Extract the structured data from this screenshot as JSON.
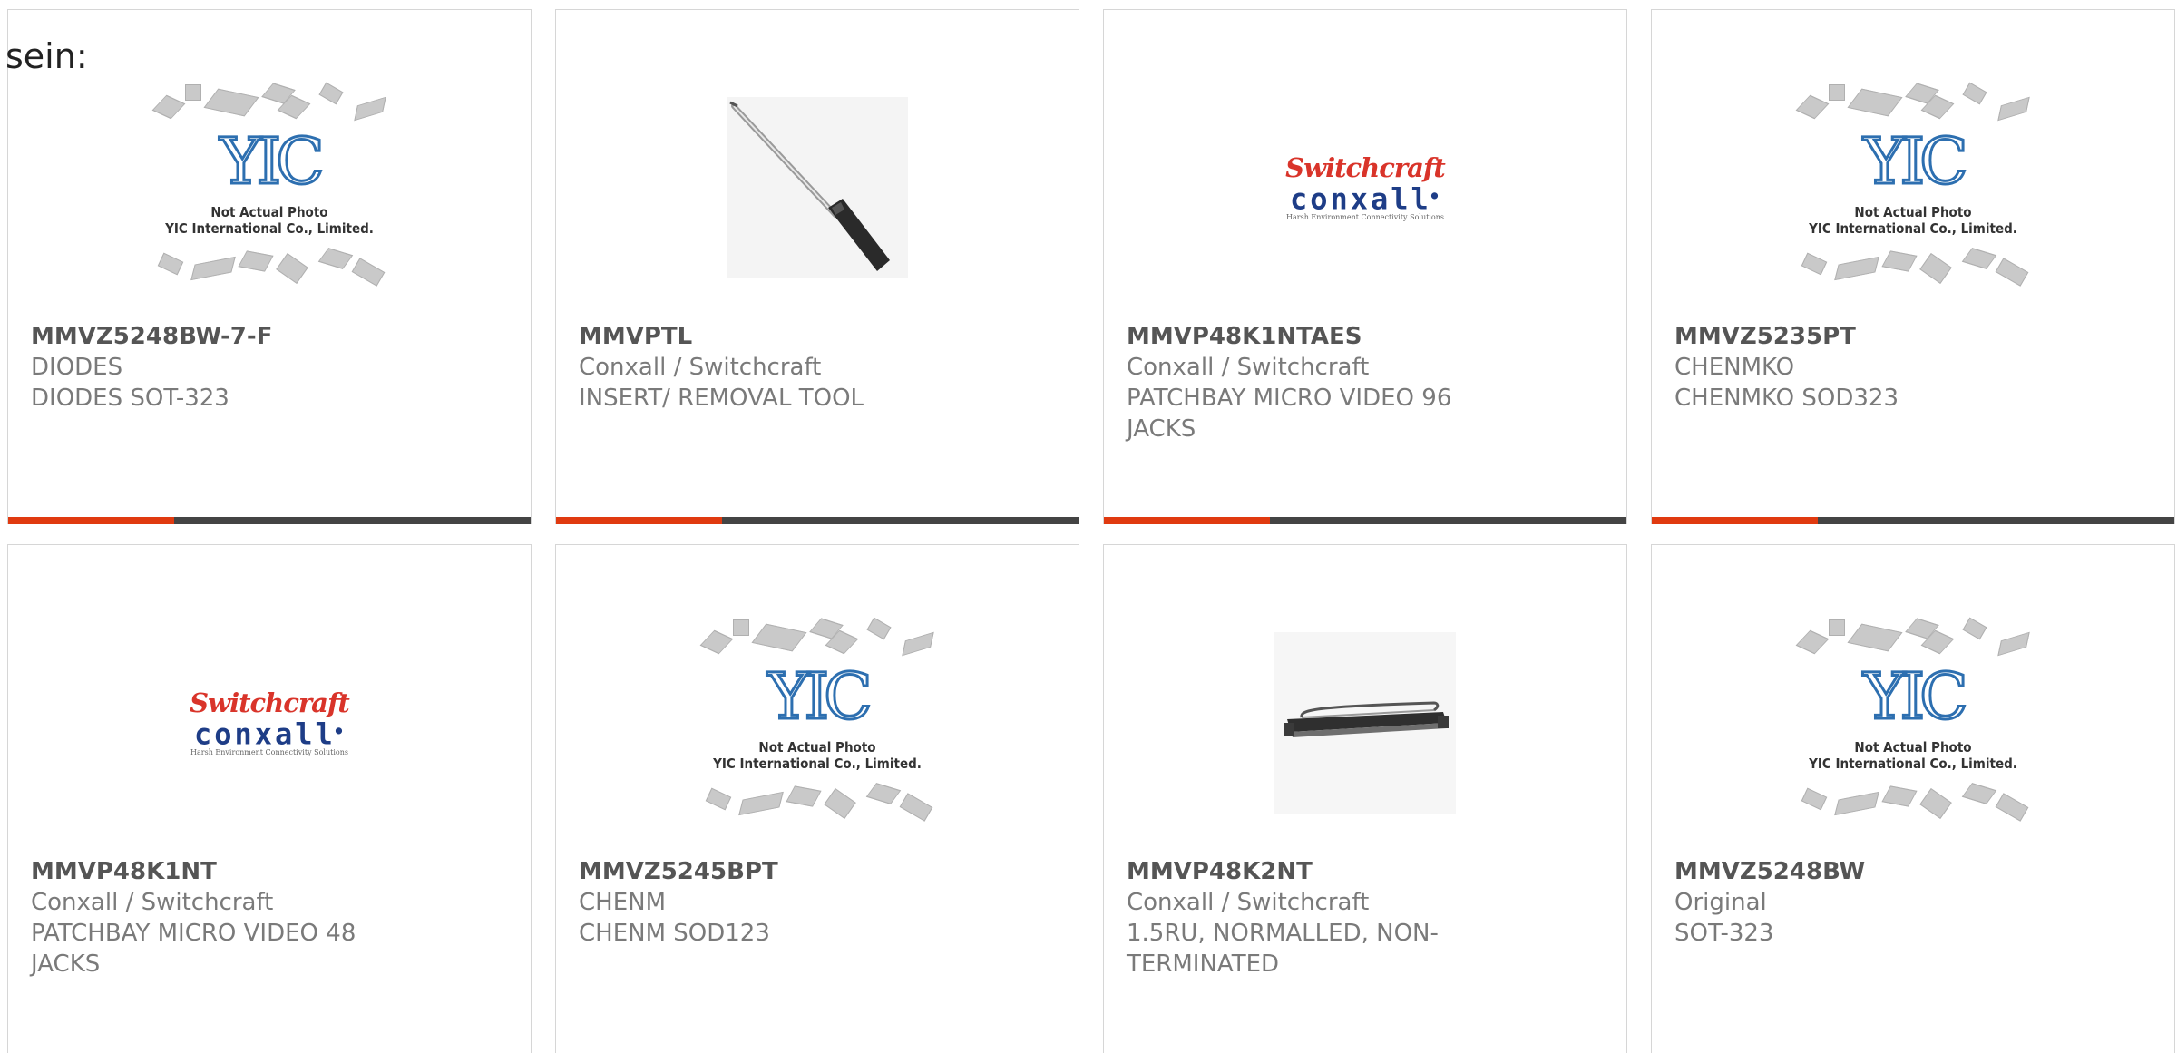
{
  "heading": "sein:",
  "products": [
    {
      "part_number": "MMVZ5248BW-7-F",
      "manufacturer": "DIODES",
      "description": "DIODES SOT-323",
      "image": "placeholder"
    },
    {
      "part_number": "MMVPTL",
      "manufacturer": "Conxall / Switchcraft",
      "description": "INSERT/ REMOVAL TOOL",
      "image": "screwdriver"
    },
    {
      "part_number": "MMVP48K1NTAES",
      "manufacturer": "Conxall / Switchcraft",
      "description": "PATCHBAY MICRO VIDEO 96 JACKS",
      "image": "switchcraft-logo"
    },
    {
      "part_number": "MMVZ5235PT",
      "manufacturer": "CHENMKO",
      "description": "CHENMKO SOD323",
      "image": "placeholder"
    },
    {
      "part_number": "MMVP48K1NT",
      "manufacturer": "Conxall / Switchcraft",
      "description": "PATCHBAY MICRO VIDEO 48 JACKS",
      "image": "switchcraft-logo"
    },
    {
      "part_number": "MMVZ5245BPT",
      "manufacturer": "CHENM",
      "description": "CHENM SOD123",
      "image": "placeholder"
    },
    {
      "part_number": "MMVP48K2NT",
      "manufacturer": "Conxall / Switchcraft",
      "description": "1.5RU, NORMALLED, NON-TERMINATED",
      "image": "patch-panel"
    },
    {
      "part_number": "MMVZ5248BW",
      "manufacturer": "Original",
      "description": "SOT-323",
      "image": "placeholder"
    }
  ],
  "placeholder_image": {
    "logo": "YIC",
    "line1": "Not Actual Photo",
    "line2": "YIC International Co., Limited."
  },
  "switchcraft_logo": {
    "top": "Switchcraft",
    "bottom": "conxall",
    "tagline": "Harsh Environment Connectivity Solutions"
  },
  "colors": {
    "accent": "#e03a10",
    "bar": "#444444",
    "border": "#d6d6d6",
    "text": "#7a7a7a"
  }
}
